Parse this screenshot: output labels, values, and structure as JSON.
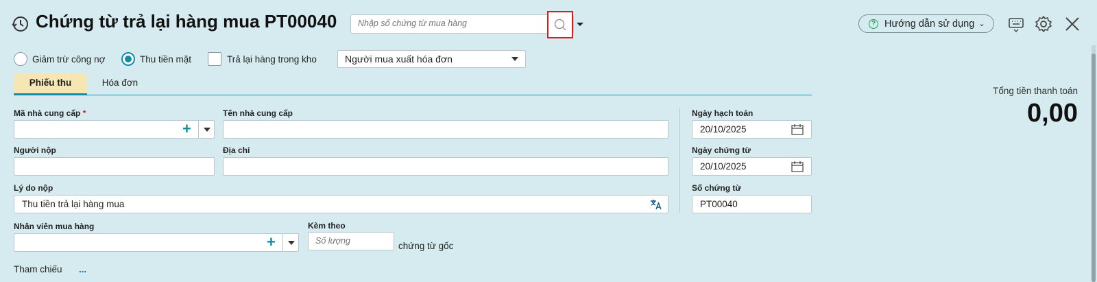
{
  "header": {
    "title": "Chứng từ trả lại hàng mua PT00040",
    "search_placeholder": "Nhập số chứng từ mua hàng",
    "help_label": "Hướng dẫn sử dụng"
  },
  "options": {
    "radio_debt": "Giảm trừ công nợ",
    "radio_cash": "Thu tiền mặt",
    "radio_selected": "Thu tiền mặt",
    "checkbox_return_stock": "Trả lại hàng trong kho",
    "checkbox_return_stock_checked": false,
    "invoice_select": "Người mua xuất hóa đơn"
  },
  "tabs": [
    "Phiếu thu",
    "Hóa đơn"
  ],
  "form": {
    "supplier_code_label": "Mã nhà cung cấp",
    "required_mark": "*",
    "supplier_code_value": "",
    "supplier_name_label": "Tên nhà cung cấp",
    "supplier_name_value": "",
    "payer_label": "Người nộp",
    "payer_value": "",
    "address_label": "Địa chỉ",
    "address_value": "",
    "reason_label": "Lý do nộp",
    "reason_value": "Thu tiền trả lại hàng mua",
    "buyer_label": "Nhân viên mua hàng",
    "buyer_value": "",
    "attach_label": "Kèm theo",
    "attach_placeholder": "Số lượng",
    "attach_suffix": "chứng từ gốc",
    "reference_label": "Tham chiếu",
    "reference_link": "..."
  },
  "dates": {
    "posting_date_label": "Ngày hạch toán",
    "posting_date_value": "20/10/2025",
    "voucher_date_label": "Ngày chứng từ",
    "voucher_date_value": "20/10/2025",
    "voucher_no_label": "Số chứng từ",
    "voucher_no_value": "PT00040"
  },
  "summary": {
    "total_label": "Tổng tiền thanh toán",
    "total_value": "0,00"
  },
  "icons": [
    "history-icon",
    "search-icon",
    "chevron-down-icon",
    "help-icon",
    "keyboard-icon",
    "gear-icon",
    "close-icon",
    "plus-icon",
    "calendar-icon",
    "translate-icon"
  ],
  "colors": {
    "background": "#d6ebef",
    "accent": "#0f8fa6",
    "active_tab": "#f5e6b4",
    "highlight_border": "#e01818"
  }
}
